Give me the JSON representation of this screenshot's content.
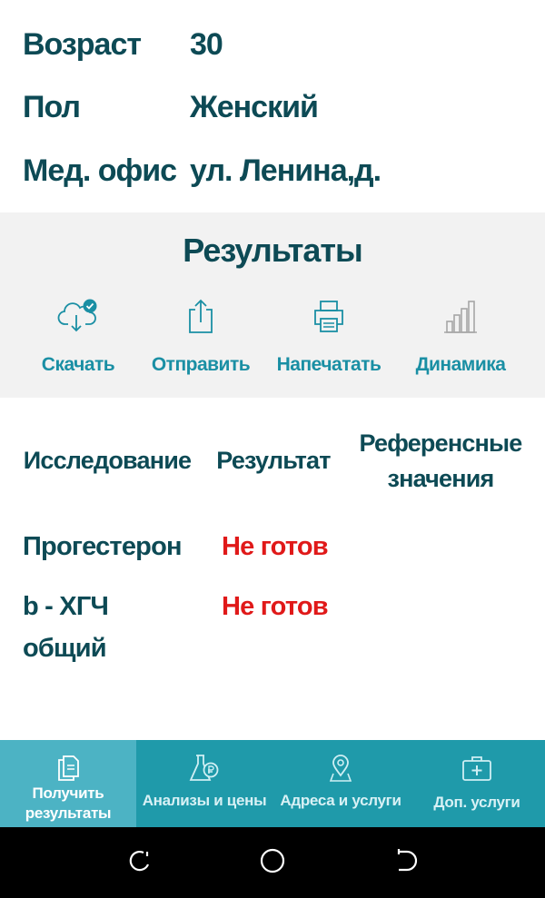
{
  "patient": {
    "age": {
      "label": "Возраст",
      "value": "30"
    },
    "sex": {
      "label": "Пол",
      "value": "Женский"
    },
    "office": {
      "label": "Мед. офис",
      "value": "ул. Ленина,д."
    }
  },
  "results": {
    "title": "Результаты",
    "actions": [
      {
        "label": "Скачать",
        "icon": "cloud-download-icon"
      },
      {
        "label": "Отправить",
        "icon": "share-icon"
      },
      {
        "label": "Напечатать",
        "icon": "print-icon"
      },
      {
        "label": "Динамика",
        "icon": "bar-chart-icon"
      }
    ]
  },
  "table": {
    "headers": {
      "study": "Исследование",
      "result": "Результат",
      "reference_line1": "Референсные",
      "reference_line2": "значения"
    },
    "rows": [
      {
        "name_line1": "Прогестерон",
        "name_line2": "",
        "result": "Не готов",
        "reference": ""
      },
      {
        "name_line1": "b - ХГЧ",
        "name_line2": "общий",
        "result": "Не готов",
        "reference": ""
      }
    ]
  },
  "tabbar": {
    "tabs": [
      {
        "label_line1": "Получить",
        "label_line2": "результаты",
        "icon": "document-icon",
        "active": true
      },
      {
        "label_line1": "Анализы и цены",
        "label_line2": "",
        "icon": "flask-icon",
        "active": false
      },
      {
        "label_line1": "Адреса и услуги",
        "label_line2": "",
        "icon": "location-pin-icon",
        "active": false
      },
      {
        "label_line1": "Доп. услуги",
        "label_line2": "",
        "icon": "first-aid-kit-icon",
        "active": false
      }
    ]
  },
  "colors": {
    "primary_text": "#0d4a55",
    "accent": "#1a8fa4",
    "tabbar": "#1f9aaa",
    "tab_active": "#4cb3c4",
    "not_ready": "#e01919",
    "band": "#f2f2f2"
  }
}
